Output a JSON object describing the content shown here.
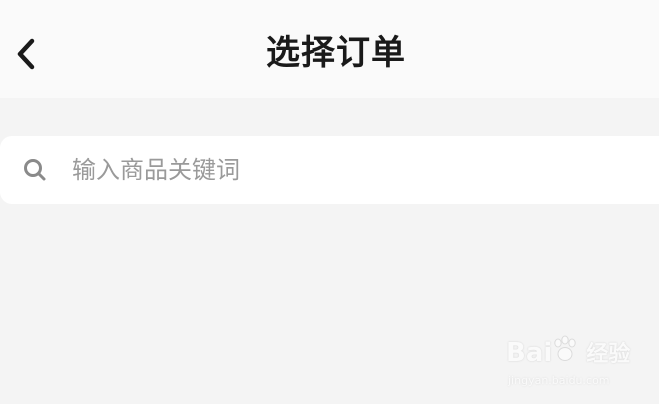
{
  "header": {
    "title": "选择订单",
    "back_icon": "chevron-left-icon"
  },
  "search": {
    "icon": "search-icon",
    "placeholder": "输入商品关键词",
    "value": ""
  },
  "watermark": {
    "logo_text": "Bai",
    "logo_text_2": "经验",
    "url": "jingyan.baidu.com"
  },
  "colors": {
    "background": "#f4f4f4",
    "header_background": "#fafafa",
    "title": "#1a1a1a",
    "placeholder": "#9a9a9a",
    "search_bar": "#ffffff"
  }
}
